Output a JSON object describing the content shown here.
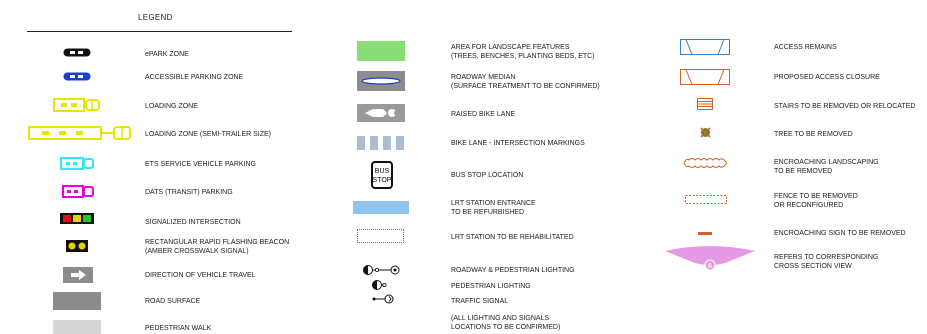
{
  "legend": {
    "title": "LEGEND"
  },
  "col1": [
    {
      "label": "ePARK ZONE"
    },
    {
      "label": "ACCESSIBLE PARKING ZONE"
    },
    {
      "label": "LOADING ZONE"
    },
    {
      "label": "LOADING ZONE (SEMI-TRAILER SIZE)"
    },
    {
      "label": "ETS SERVICE VEHICLE PARKING"
    },
    {
      "label": "DATS (TRANSIT) PARKING"
    },
    {
      "label": "SIGNALIZED INTERSECTION"
    },
    {
      "label": "RECTANGULAR RAPID FLASHING BEACON",
      "label2": "(AMBER CROSSWALK SIGNAL)"
    },
    {
      "label": "DIRECTION OF VEHICLE TRAVEL"
    },
    {
      "label": "ROAD SURFACE"
    },
    {
      "label": "PEDESTRIAN WALK"
    }
  ],
  "col2": [
    {
      "label": "AREA FOR LANDSCAPE FEATURES",
      "label2": "(TREES, BENCHES, PLANTING BEDS, ETC)"
    },
    {
      "label": "ROADWAY MEDIAN",
      "label2": "(SURFACE TREATMENT TO BE CONFIRMED)"
    },
    {
      "label": "RAISED BIKE LANE"
    },
    {
      "label": "BIKE LANE - INTERSECTION MARKINGS"
    },
    {
      "label": "BUS STOP LOCATION",
      "sign_line1": "BUS",
      "sign_line2": "STOP"
    },
    {
      "label": "LRT STATION ENTRANCE",
      "label2": "TO BE REFURBISHED"
    },
    {
      "label": "LRT STATION TO BE REHABILITATED"
    },
    {
      "label": "ROADWAY & PEDESTRIAN LIGHTING"
    },
    {
      "label": "PEDESTRIAN LIGHTING"
    },
    {
      "label": "TRAFFIC SIGNAL"
    },
    {
      "label": "(ALL LIGHTING AND SIGNALS",
      "label2": "LOCATIONS TO BE CONFIRMED)"
    }
  ],
  "col3": [
    {
      "label": "ACCESS REMAINS"
    },
    {
      "label": "PROPOSED ACCESS CLOSURE"
    },
    {
      "label": "STAIRS TO BE REMOVED OR RELOCATED"
    },
    {
      "label": "TREE TO BE REMOVED"
    },
    {
      "label": "ENCROACHING LANDSCAPING",
      "label2": "TO BE REMOVED"
    },
    {
      "label": "FENCE TO BE REMOVED",
      "label2": "OR RECONFIGURED"
    },
    {
      "label": "ENCROACHING SIGN TO BE REMOVED"
    },
    {
      "label": "REFERS TO CORRESPONDING",
      "label2": "CROSS SECTION VIEW",
      "marker": "A"
    }
  ],
  "colors": {
    "black": "#111111",
    "blue": "#1a3fd0",
    "yellow": "#e6e600",
    "cyan": "#33e6f2",
    "magenta": "#e600e6",
    "red": "#e01010",
    "green_light": "#26c426",
    "amber": "#e8d400",
    "gray_dark": "#8c8c8c",
    "gray_light": "#d6d6d6",
    "landscape_green": "#88dd77",
    "lrt_blue": "#8fc4ee",
    "access_blue": "#3a7fc8",
    "closure_orange": "#d2602a",
    "section_pink": "#e69ae6"
  }
}
